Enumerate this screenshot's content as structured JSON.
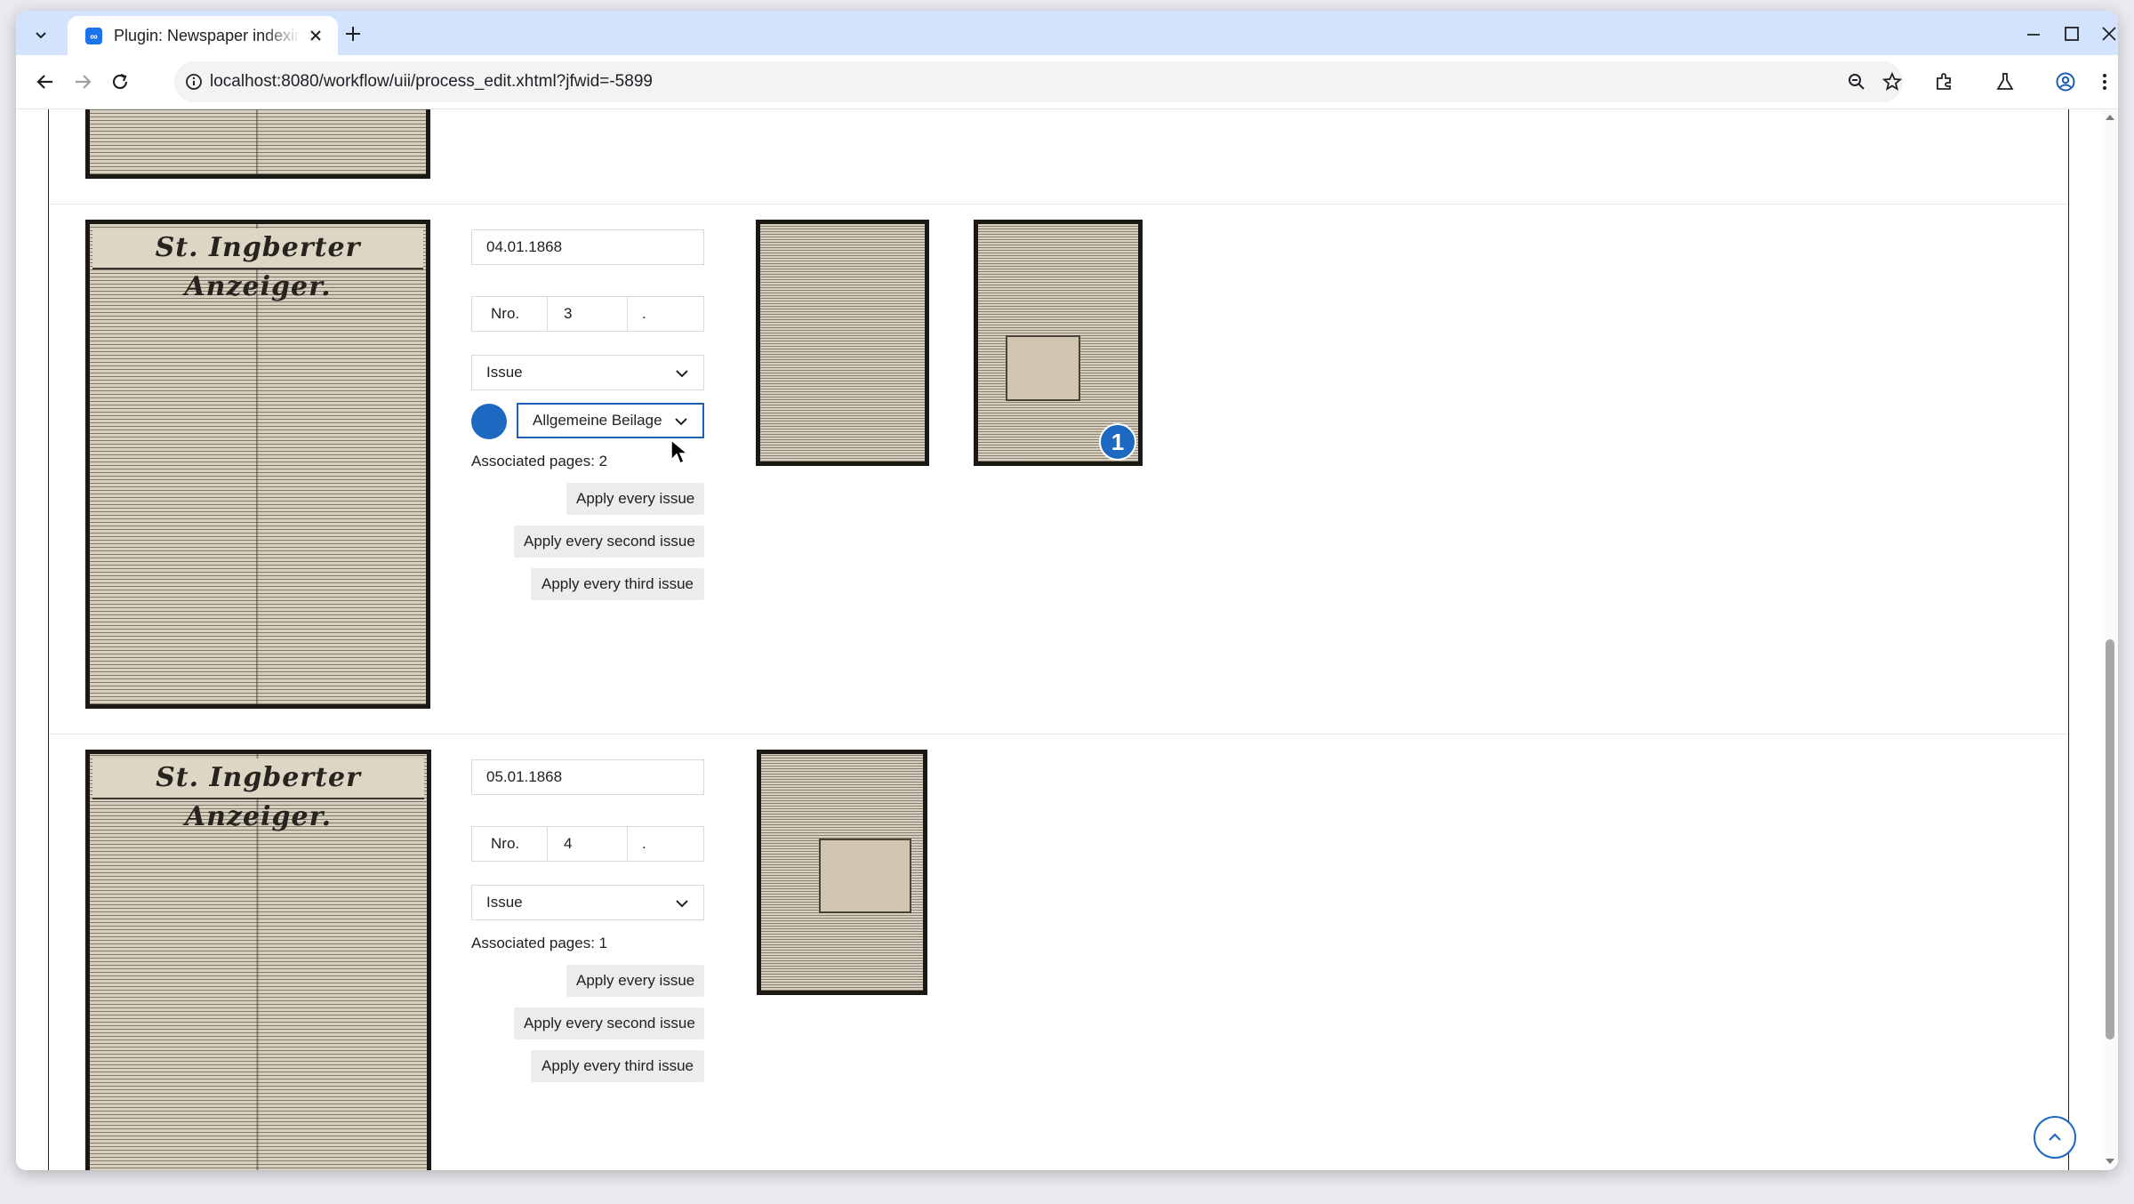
{
  "browser": {
    "tab_title": "Plugin: Newspaper indexing",
    "url": "localhost:8080/workflow/uii/process_edit.xhtml?jfwid=-5899"
  },
  "issues": [
    {
      "date": "04.01.1868",
      "nro_label": "Nro.",
      "number": "3",
      "suffix": ".",
      "type": "Issue",
      "supplement": "Allgemeine Beilage",
      "associated_pages": "Associated pages: 2",
      "masthead": "St. Ingberter Anzeiger.",
      "buttons": {
        "apply_every": "Apply every issue",
        "apply_second": "Apply every second issue",
        "apply_third": "Apply every third issue"
      },
      "thumbnail_badge": "1"
    },
    {
      "date": "05.01.1868",
      "nro_label": "Nro.",
      "number": "4",
      "suffix": ".",
      "type": "Issue",
      "associated_pages": "Associated pages: 1",
      "masthead": "St. Ingberter Anzeiger.",
      "buttons": {
        "apply_every": "Apply every issue",
        "apply_second": "Apply every second issue",
        "apply_third": "Apply every third issue"
      }
    }
  ],
  "colors": {
    "accent": "#1d68c1",
    "tabstrip": "#d3e3fd"
  }
}
